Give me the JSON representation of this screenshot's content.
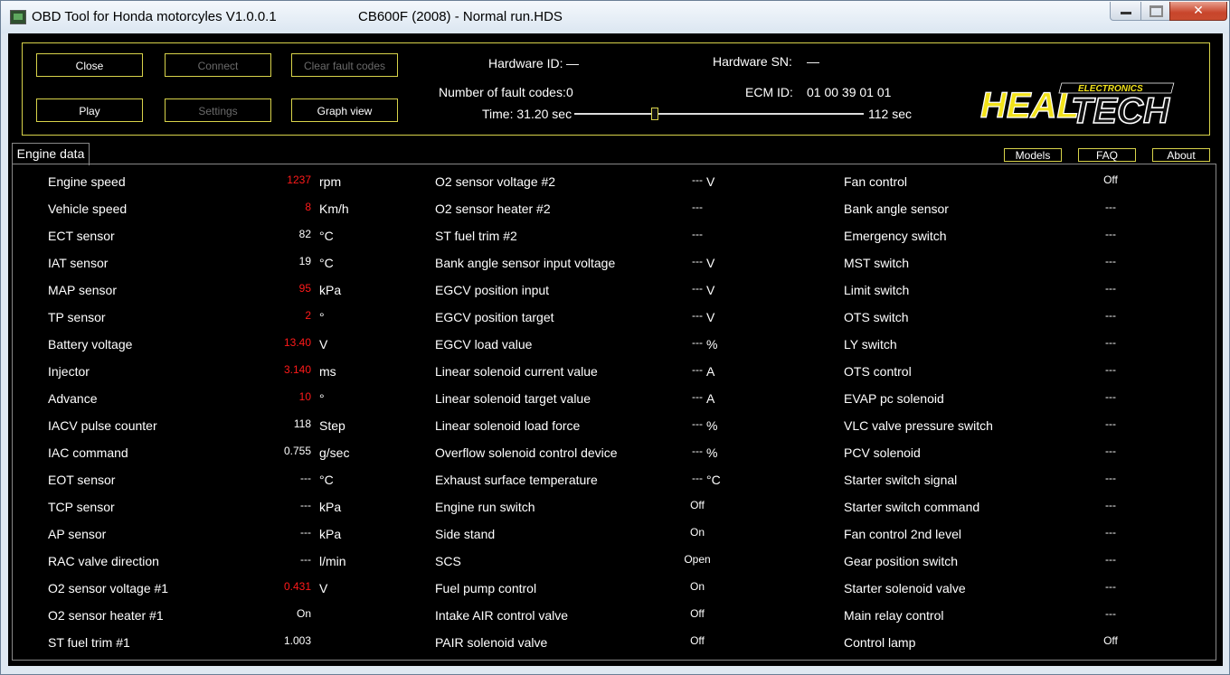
{
  "window": {
    "title": "OBD Tool for Honda motorcyles V1.0.0.1",
    "subtitle": "CB600F (2008) - Normal run.HDS",
    "close_symbol": "✕"
  },
  "buttons": {
    "close": "Close",
    "connect": "Connect",
    "clear_fault_codes": "Clear fault codes",
    "play": "Play",
    "settings": "Settings",
    "graph_view": "Graph view"
  },
  "info": {
    "hardware_id_label": "Hardware ID:",
    "hardware_id_value": "—",
    "hardware_sn_label": "Hardware SN:",
    "hardware_sn_value": "—",
    "fault_codes_label": "Number of fault codes:",
    "fault_codes_value": "0",
    "ecm_id_label": "ECM ID:",
    "ecm_id_value": "01 00 39 01 01",
    "time_label": "Time: 31.20 sec",
    "time_end": "112 sec",
    "time_current": 31.2,
    "time_total": 112
  },
  "logo": {
    "main": "HEAL",
    "tech": "TECH",
    "sub": "ELECTRONICS"
  },
  "tabs": {
    "engine_data": "Engine data"
  },
  "side_buttons": {
    "models": "Models",
    "faq": "FAQ",
    "about": "About"
  },
  "columns": {
    "left": [
      {
        "label": "Engine speed",
        "value": "1237",
        "unit": "rpm",
        "alert": true
      },
      {
        "label": "Vehicle speed",
        "value": "8",
        "unit": "Km/h",
        "alert": true
      },
      {
        "label": "ECT sensor",
        "value": "82",
        "unit": "°C",
        "alert": false
      },
      {
        "label": "IAT sensor",
        "value": "19",
        "unit": "°C",
        "alert": false
      },
      {
        "label": "MAP sensor",
        "value": "95",
        "unit": "kPa",
        "alert": true
      },
      {
        "label": "TP sensor",
        "value": "2",
        "unit": "°",
        "alert": true
      },
      {
        "label": "Battery voltage",
        "value": "13.40",
        "unit": "V",
        "alert": true
      },
      {
        "label": "Injector",
        "value": "3.140",
        "unit": "ms",
        "alert": true
      },
      {
        "label": "Advance",
        "value": "10",
        "unit": "°",
        "alert": true
      },
      {
        "label": "IACV pulse counter",
        "value": "118",
        "unit": "Step",
        "alert": false
      },
      {
        "label": "IAC command",
        "value": "0.755",
        "unit": "g/sec",
        "alert": false
      },
      {
        "label": "EOT sensor",
        "value": "---",
        "unit": "°C",
        "alert": false
      },
      {
        "label": "TCP sensor",
        "value": "---",
        "unit": "kPa",
        "alert": false
      },
      {
        "label": "AP sensor",
        "value": "---",
        "unit": "kPa",
        "alert": false
      },
      {
        "label": "RAC valve direction",
        "value": "---",
        "unit": "l/min",
        "alert": false
      },
      {
        "label": "O2 sensor voltage #1",
        "value": "0.431",
        "unit": "V",
        "alert": true
      },
      {
        "label": "O2 sensor heater #1",
        "value": "On",
        "unit": "",
        "alert": false
      },
      {
        "label": "ST fuel trim #1",
        "value": "1.003",
        "unit": "",
        "alert": false
      }
    ],
    "middle": [
      {
        "label": "O2 sensor voltage #2",
        "value": "---",
        "unit": "V"
      },
      {
        "label": "O2 sensor heater #2",
        "value": "---",
        "unit": ""
      },
      {
        "label": "ST fuel trim #2",
        "value": "---",
        "unit": ""
      },
      {
        "label": "Bank angle sensor input voltage",
        "value": "---",
        "unit": "V"
      },
      {
        "label": "EGCV position input",
        "value": "---",
        "unit": "V"
      },
      {
        "label": "EGCV position target",
        "value": "---",
        "unit": "V"
      },
      {
        "label": "EGCV load value",
        "value": "---",
        "unit": "%"
      },
      {
        "label": "Linear solenoid current value",
        "value": "---",
        "unit": "A"
      },
      {
        "label": "Linear solenoid target value",
        "value": "---",
        "unit": "A"
      },
      {
        "label": "Linear solenoid load force",
        "value": "---",
        "unit": "%"
      },
      {
        "label": "Overflow solenoid control device",
        "value": "---",
        "unit": "%"
      },
      {
        "label": "Exhaust surface temperature",
        "value": "---",
        "unit": "°C"
      },
      {
        "label": "Engine run switch",
        "value": "Off",
        "unit": ""
      },
      {
        "label": "Side stand",
        "value": "On",
        "unit": ""
      },
      {
        "label": "SCS",
        "value": "Open",
        "unit": ""
      },
      {
        "label": "Fuel pump control",
        "value": "On",
        "unit": ""
      },
      {
        "label": "Intake AIR control valve",
        "value": "Off",
        "unit": ""
      },
      {
        "label": "PAIR solenoid valve",
        "value": "Off",
        "unit": ""
      }
    ],
    "right": [
      {
        "label": "Fan control",
        "value": "Off"
      },
      {
        "label": "Bank angle sensor",
        "value": "---"
      },
      {
        "label": "Emergency switch",
        "value": "---"
      },
      {
        "label": "MST switch",
        "value": "---"
      },
      {
        "label": "Limit switch",
        "value": "---"
      },
      {
        "label": "OTS switch",
        "value": "---"
      },
      {
        "label": "LY switch",
        "value": "---"
      },
      {
        "label": "OTS control",
        "value": "---"
      },
      {
        "label": "EVAP pc solenoid",
        "value": "---"
      },
      {
        "label": "VLC valve pressure switch",
        "value": "---"
      },
      {
        "label": "PCV solenoid",
        "value": "---"
      },
      {
        "label": "Starter switch signal",
        "value": "---"
      },
      {
        "label": "Starter switch command",
        "value": "---"
      },
      {
        "label": "Fan control 2nd level",
        "value": "---"
      },
      {
        "label": "Gear position switch",
        "value": "---"
      },
      {
        "label": "Starter solenoid valve",
        "value": "---"
      },
      {
        "label": "Main relay control",
        "value": "---"
      },
      {
        "label": "Control lamp",
        "value": "Off"
      }
    ]
  },
  "colors": {
    "accent_border": "#d8d34a",
    "alert_value": "#ff1a1a",
    "background": "#000000",
    "text": "#ffffff",
    "logo_yellow": "#f2e21a"
  }
}
